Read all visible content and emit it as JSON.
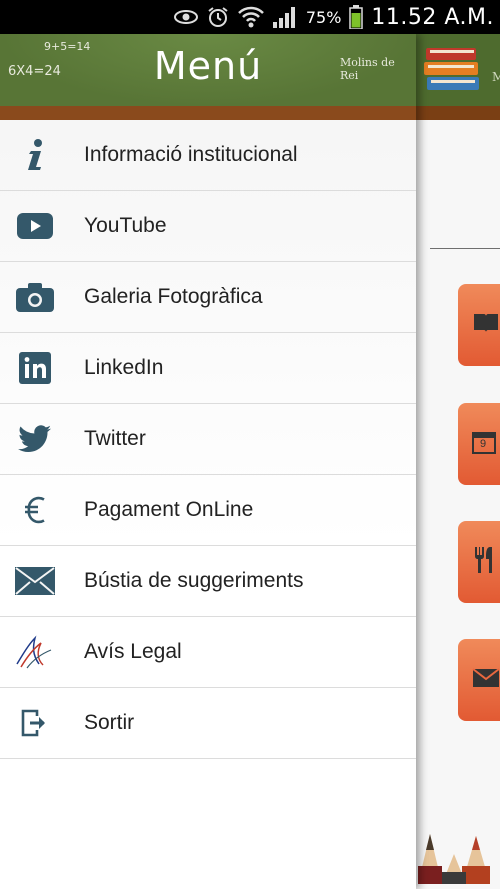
{
  "status_bar": {
    "battery_percent": "75%",
    "time": "11.52 A.M."
  },
  "drawer": {
    "title": "Menú",
    "chalk_eq1": "9+5=14",
    "chalk_eq2": "6X4=24",
    "chalk_place": "Molins de Rei",
    "items": [
      {
        "label": "Informació institucional",
        "icon": "info-icon"
      },
      {
        "label": "YouTube",
        "icon": "youtube-icon"
      },
      {
        "label": "Galeria Fotogràfica",
        "icon": "camera-icon"
      },
      {
        "label": "LinkedIn",
        "icon": "linkedin-icon"
      },
      {
        "label": "Twitter",
        "icon": "twitter-icon"
      },
      {
        "label": "Pagament OnLine",
        "icon": "euro-icon"
      },
      {
        "label": "Bústia de suggeriments",
        "icon": "mail-icon"
      },
      {
        "label": "Avís Legal",
        "icon": "legal-logo-icon"
      },
      {
        "label": "Sortir",
        "icon": "exit-icon"
      }
    ]
  },
  "background_app": {
    "header_text": "M",
    "tiles": [
      "book-icon",
      "calendar-icon",
      "cutlery-icon",
      "mail-icon"
    ],
    "calendar_day": "9"
  },
  "colors": {
    "header_green": "#5d7c3a",
    "header_brown": "#8a4a1c",
    "icon_blue": "#34586a",
    "tile_orange": "#e9683f"
  }
}
